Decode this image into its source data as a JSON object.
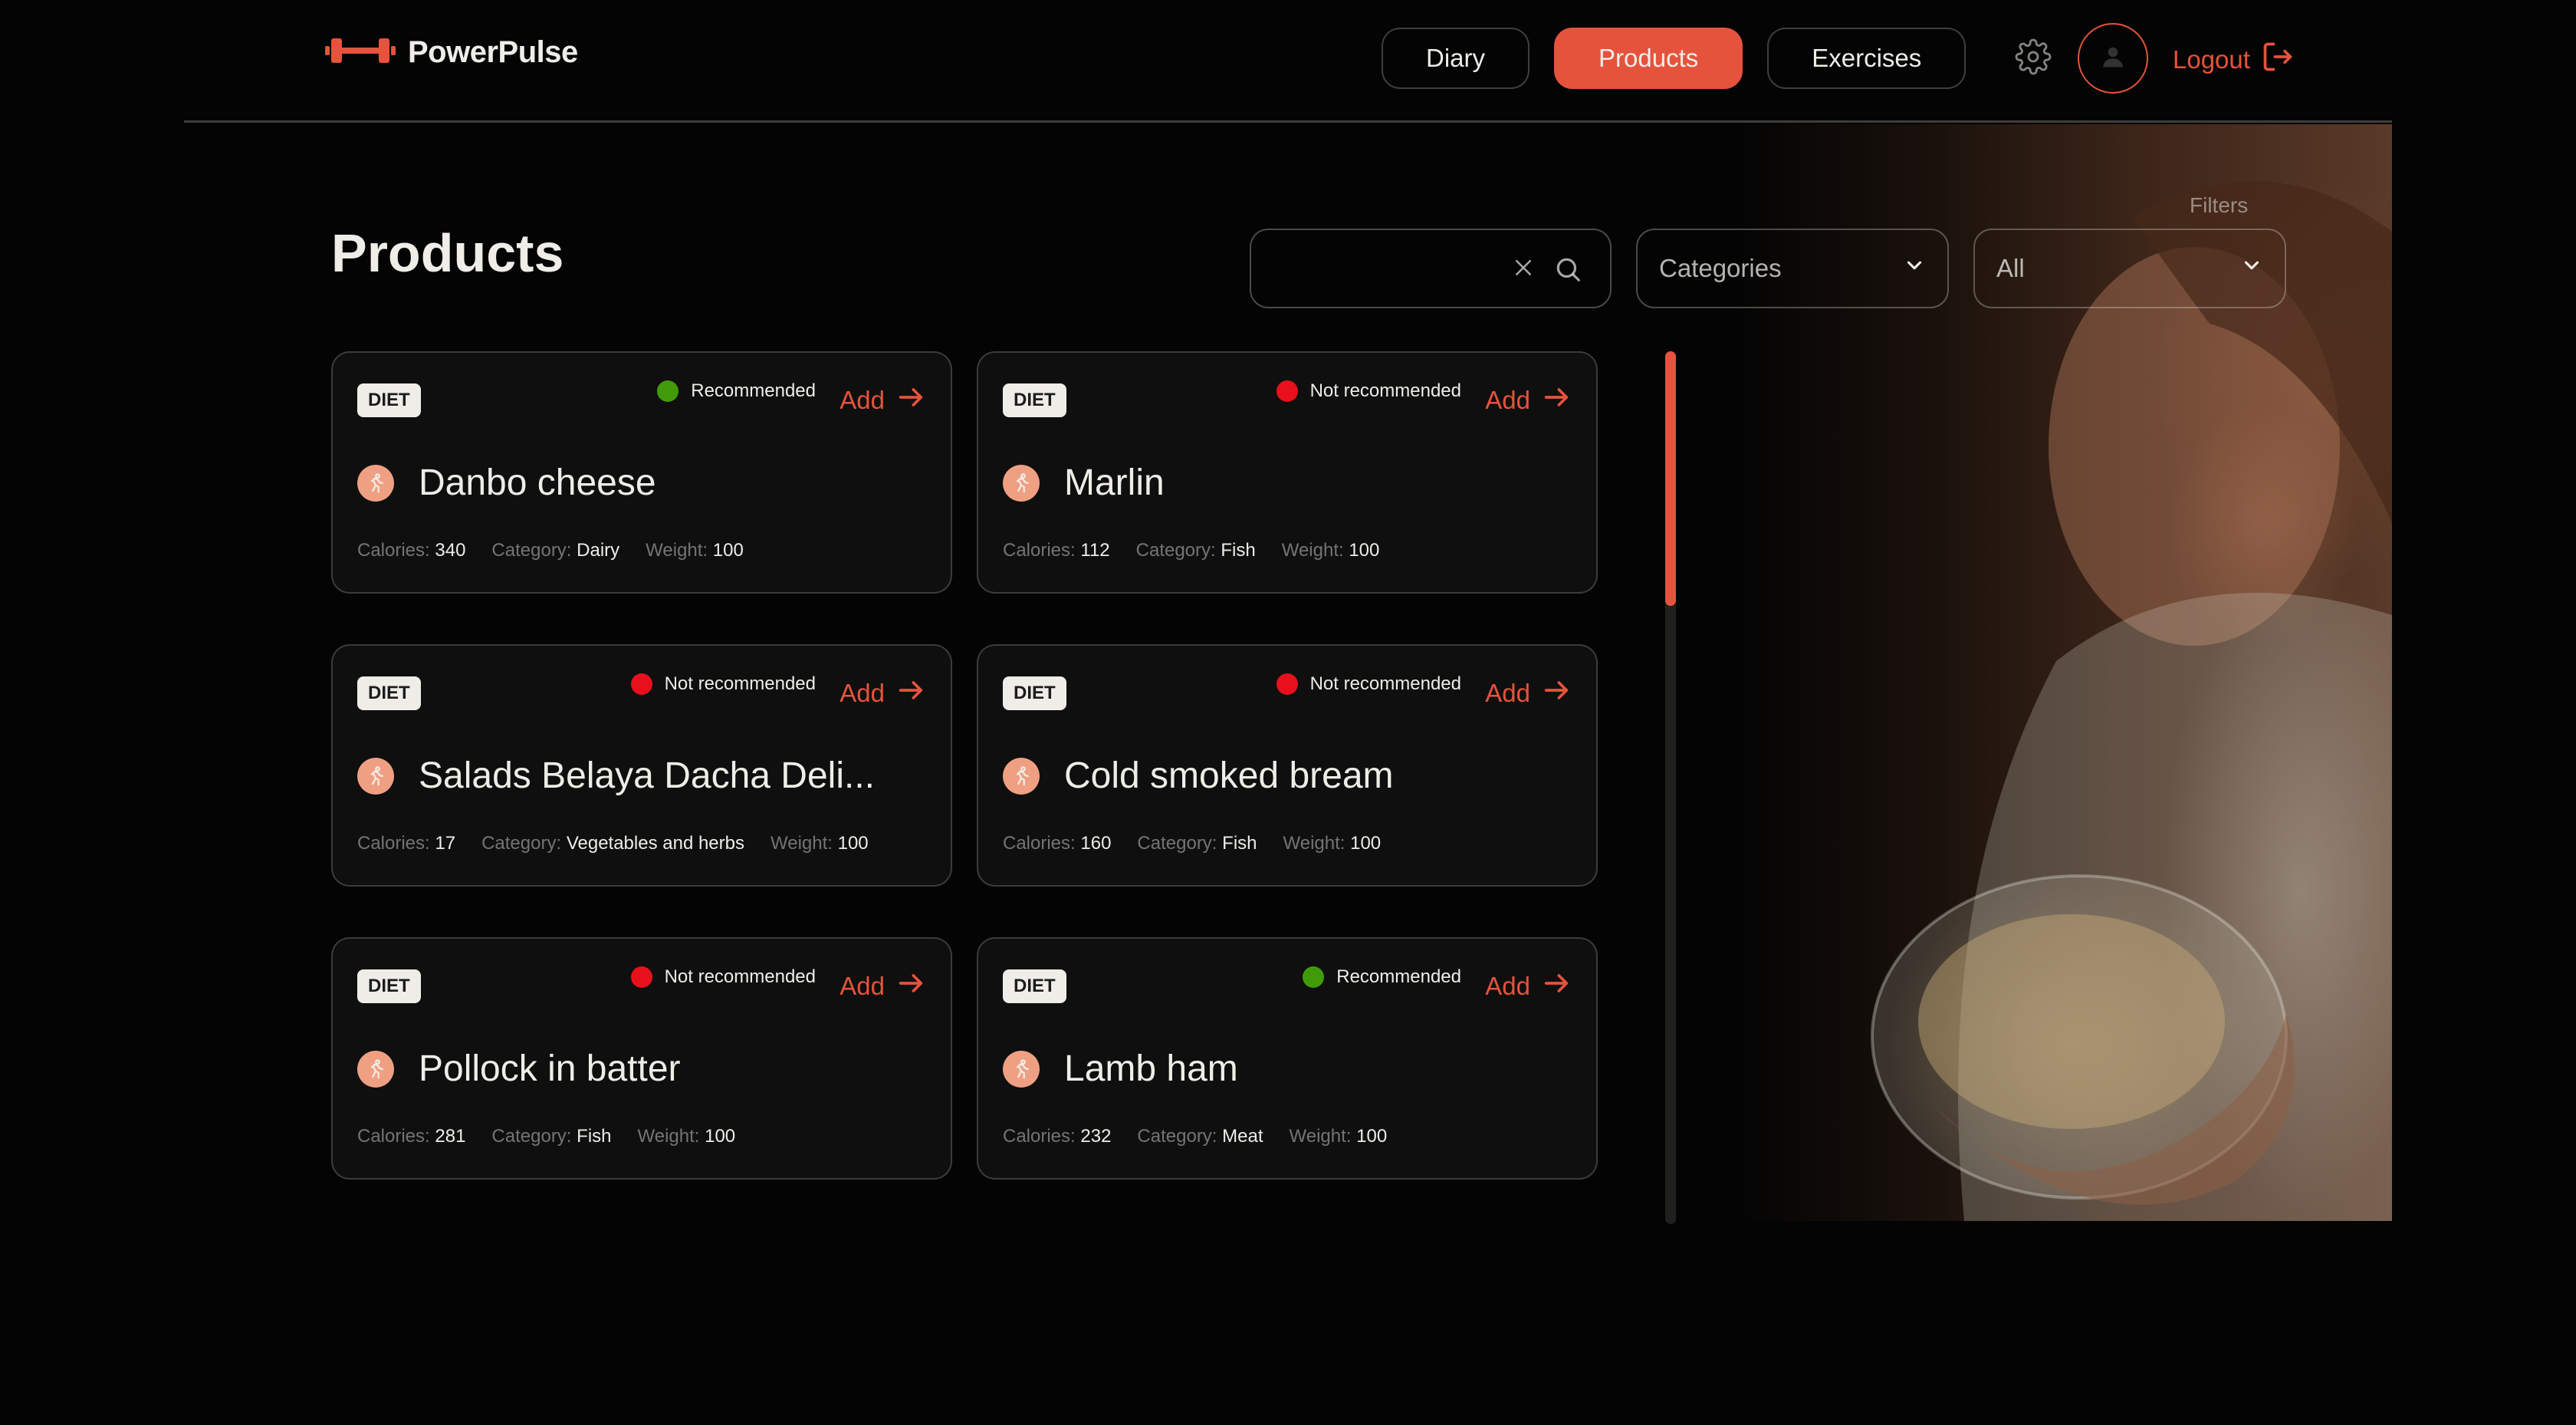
{
  "app": {
    "name": "PowerPulse"
  },
  "nav": {
    "items": [
      {
        "label": "Diary",
        "active": false
      },
      {
        "label": "Products",
        "active": true
      },
      {
        "label": "Exercises",
        "active": false
      }
    ],
    "logout_label": "Logout"
  },
  "page": {
    "title": "Products"
  },
  "filters": {
    "label": "Filters",
    "search_value": "",
    "categories_value": "Categories",
    "recommended_value": "All"
  },
  "labels": {
    "calories": "Calories:",
    "category": "Category:",
    "weight": "Weight:",
    "add": "Add"
  },
  "products": [
    {
      "badge": "DIET",
      "status": "Recommended",
      "recommended": true,
      "name": "Danbo cheese",
      "calories": "340",
      "category": "Dairy",
      "weight": "100"
    },
    {
      "badge": "DIET",
      "status": "Not recommended",
      "recommended": false,
      "name": "Marlin",
      "calories": "112",
      "category": "Fish",
      "weight": "100"
    },
    {
      "badge": "DIET",
      "status": "Not recommended",
      "recommended": false,
      "name": "Salads Belaya Dacha Deli...",
      "calories": "17",
      "category": "Vegetables and herbs",
      "weight": "100"
    },
    {
      "badge": "DIET",
      "status": "Not recommended",
      "recommended": false,
      "name": "Cold smoked bream",
      "calories": "160",
      "category": "Fish",
      "weight": "100"
    },
    {
      "badge": "DIET",
      "status": "Not recommended",
      "recommended": false,
      "name": "Pollock in batter",
      "calories": "281",
      "category": "Fish",
      "weight": "100"
    },
    {
      "badge": "DIET",
      "status": "Recommended",
      "recommended": true,
      "name": "Lamb ham",
      "calories": "232",
      "category": "Meat",
      "weight": "100"
    }
  ],
  "colors": {
    "accent": "#e6533c",
    "recommended": "#419b09",
    "not_recommended": "#e9101d"
  },
  "scroll": {
    "position_fraction": 0.0,
    "visible_fraction": 0.29
  }
}
